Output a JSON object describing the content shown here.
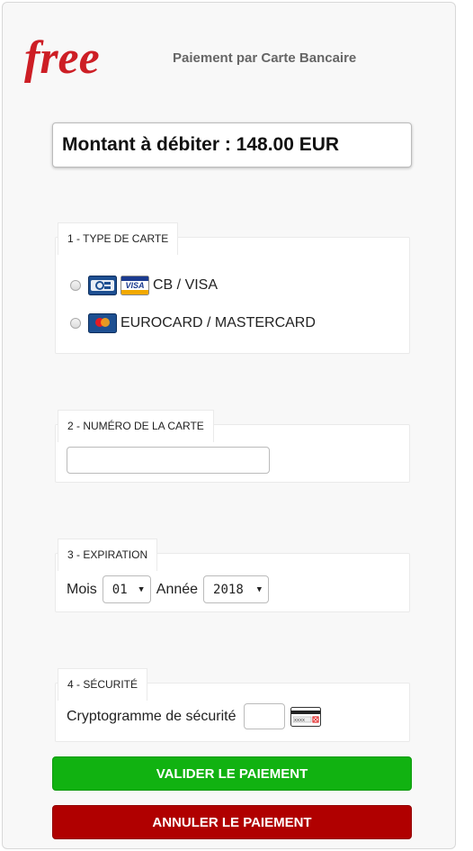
{
  "header": {
    "logo_text": "free",
    "title": "Paiement par Carte Bancaire"
  },
  "amount": {
    "label": "Montant à débiter : 148.00 EUR"
  },
  "card_type": {
    "legend": "1 - TYPE DE CARTE",
    "options": [
      {
        "label": "CB / VISA",
        "selected": false,
        "icons": [
          "cb-card-icon",
          "visa-card-icon"
        ]
      },
      {
        "label": "EUROCARD / MASTERCARD",
        "selected": false,
        "icons": [
          "mastercard-icon"
        ]
      }
    ]
  },
  "card_number": {
    "legend": "2 - NUMÉRO DE LA CARTE",
    "value": ""
  },
  "expiration": {
    "legend": "3 - EXPIRATION",
    "month_label": "Mois",
    "month_value": "01",
    "year_label": "Année",
    "year_value": "2018"
  },
  "security": {
    "legend": "4 - SÉCURITÉ",
    "cvv_label": "Cryptogramme de sécurité",
    "cvv_value": "",
    "cvv_icon_text": "xxxx"
  },
  "actions": {
    "validate_label": "VALIDER LE PAIEMENT",
    "cancel_label": "ANNULER LE PAIEMENT"
  },
  "colors": {
    "logo_red": "#cd1e25",
    "validate_green": "#11b211",
    "cancel_red": "#b00000"
  }
}
